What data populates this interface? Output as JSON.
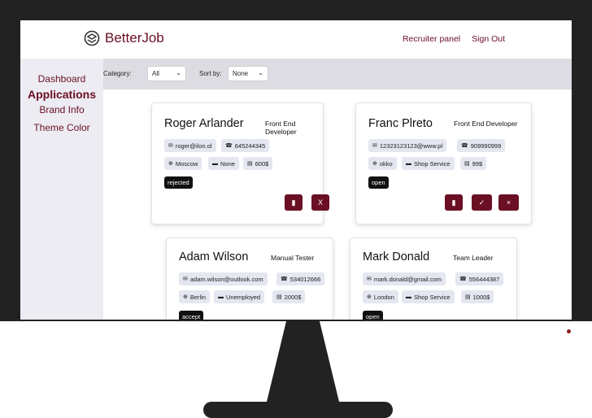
{
  "header": {
    "brand": "BetterJob",
    "links": [
      "Recruiter panel",
      "Sign Out"
    ]
  },
  "sidebar": {
    "items": [
      {
        "label": "Dashboard",
        "active": false
      },
      {
        "label": "Applications",
        "active": true
      },
      {
        "label": "Brand Info",
        "active": false
      },
      {
        "label": "Theme Color",
        "active": false
      }
    ]
  },
  "filters": {
    "category_label": "Category:",
    "category_value": "All",
    "sort_label": "Sort by:",
    "sort_value": "None"
  },
  "cards": [
    {
      "name": "Roger Arlander",
      "role": "Front End Developer",
      "email": "roger@ilon.ol",
      "phone": "645244345",
      "location": "Moscow",
      "employment": "None",
      "salary": "600$",
      "status": "rejected",
      "actions": [
        "document",
        "X"
      ]
    },
    {
      "name": "Franc Plreto",
      "role": "Front End Developer",
      "email": "12323123123@www.pl",
      "phone": "909990999",
      "location": "okko",
      "employment": "Shop Service",
      "salary": "99$",
      "status": "open",
      "actions": [
        "document",
        "✓",
        "×"
      ]
    },
    {
      "name": "Adam Wilson",
      "role": "Manual Tester",
      "email": "adam.wilson@outlook.com",
      "phone": "534012666",
      "location": "Berlin",
      "employment": "Unemployed",
      "salary": "2000$",
      "status": "accept",
      "actions": []
    },
    {
      "name": "Mark Donald",
      "role": "Team Leader",
      "email": "mark.donald@gmail.com",
      "phone": "556444387",
      "location": "London",
      "employment": "Shop Service",
      "salary": "1000$",
      "status": "open",
      "actions": []
    }
  ],
  "icons": {
    "email": "✉",
    "phone": "☎",
    "location": "⊕",
    "employment": "▬",
    "salary": "▤",
    "document": "▮"
  },
  "colors": {
    "accent": "#6b0f24",
    "sidebar_bg": "#ececf2",
    "filter_bg": "#dcdce2",
    "chip_bg": "#e4e6f0",
    "monitor": "#222222"
  }
}
